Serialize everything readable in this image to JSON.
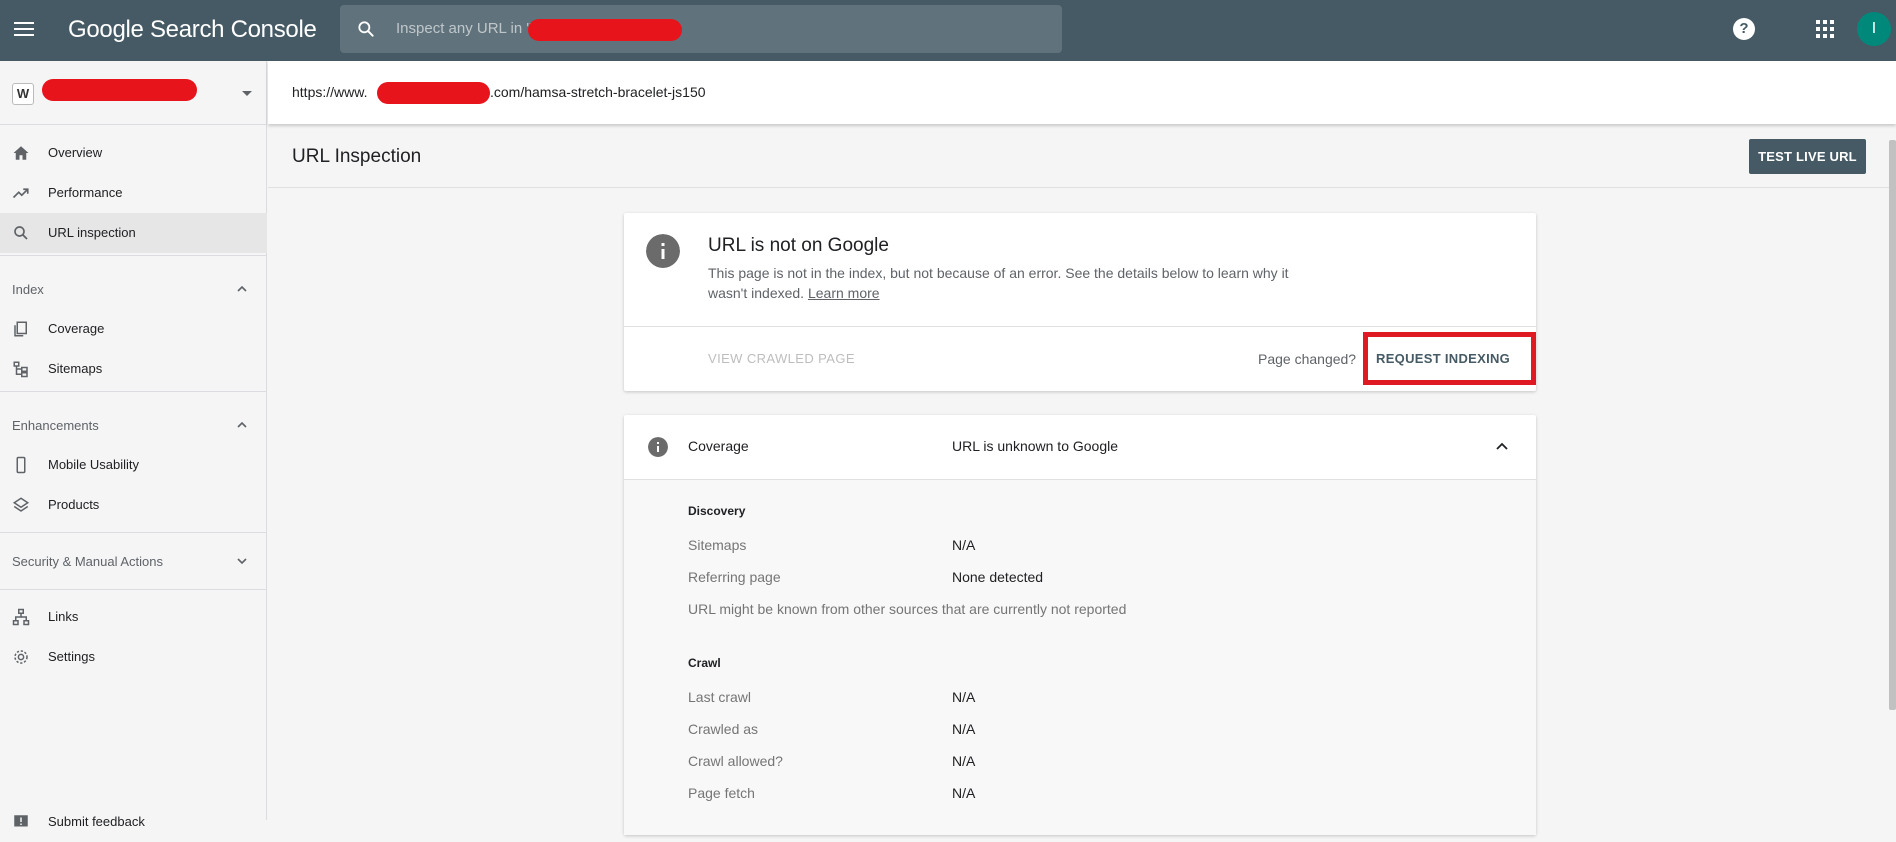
{
  "app": {
    "brand": "Google Search Console"
  },
  "search": {
    "placeholder": "Inspect any URL in \""
  },
  "topbar": {
    "help_label": "?",
    "avatar_letter": "I"
  },
  "property": {
    "logo_letter": "W"
  },
  "sidebar": {
    "overview": "Overview",
    "performance": "Performance",
    "url_inspection": "URL inspection",
    "index_heading": "Index",
    "coverage": "Coverage",
    "sitemaps": "Sitemaps",
    "enhancements_heading": "Enhancements",
    "mobile_usability": "Mobile Usability",
    "products": "Products",
    "security_heading": "Security & Manual Actions",
    "links": "Links",
    "settings": "Settings",
    "submit_feedback": "Submit feedback"
  },
  "urlbar": {
    "prefix": "https://www.",
    "suffix": ".com/hamsa-stretch-bracelet-js150"
  },
  "page": {
    "title": "URL Inspection",
    "test_live_url": "TEST LIVE URL"
  },
  "status_card": {
    "title": "URL is not on Google",
    "description": "This page is not in the index, but not because of an error. See the details below to learn why it wasn't indexed.",
    "learn_more": "Learn more",
    "view_crawled": "VIEW CRAWLED PAGE",
    "page_changed": "Page changed?",
    "request_indexing": "REQUEST INDEXING"
  },
  "coverage_card": {
    "label": "Coverage",
    "value": "URL is unknown to Google",
    "discovery_heading": "Discovery",
    "sitemaps_label": "Sitemaps",
    "sitemaps_value": "N/A",
    "referring_label": "Referring page",
    "referring_value": "None detected",
    "note": "URL might be known from other sources that are currently not reported",
    "crawl_heading": "Crawl",
    "last_crawl_label": "Last crawl",
    "last_crawl_value": "N/A",
    "crawled_as_label": "Crawled as",
    "crawled_as_value": "N/A",
    "crawl_allowed_label": "Crawl allowed?",
    "crawl_allowed_value": "N/A",
    "page_fetch_label": "Page fetch",
    "page_fetch_value": "N/A"
  }
}
